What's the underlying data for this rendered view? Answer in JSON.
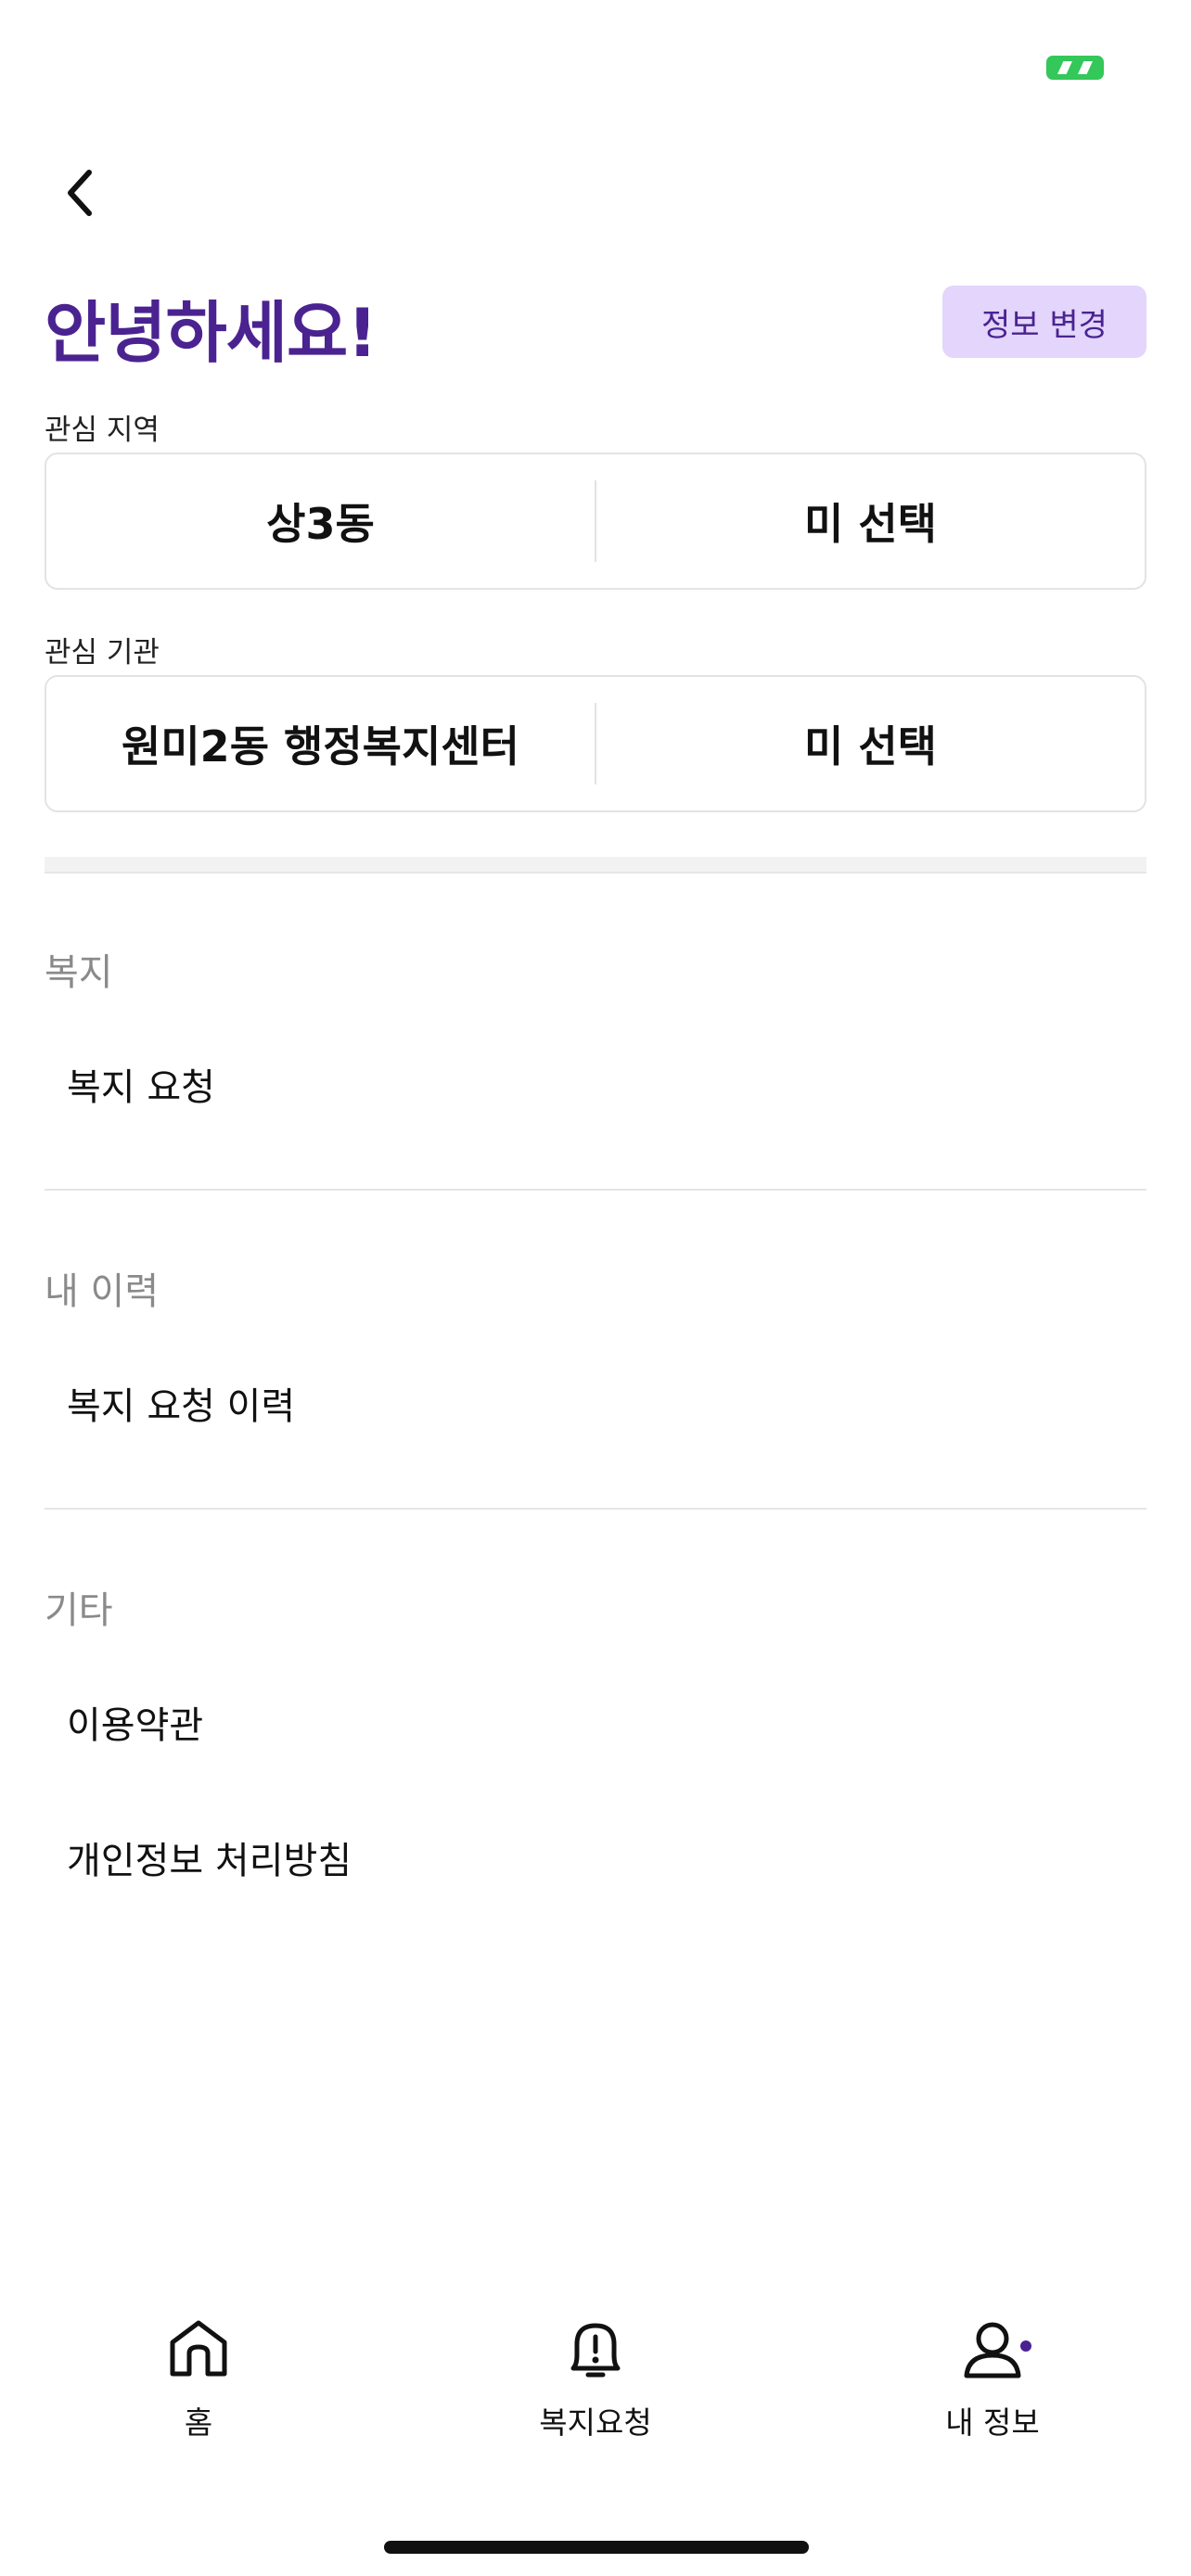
{
  "status_bar": {
    "indicator_color": "#34c759"
  },
  "header": {
    "back_icon": "chevron-left-icon"
  },
  "greeting": "안녕하세요!",
  "edit_button": "정보 변경",
  "interest_region": {
    "label": "관심 지역",
    "first": "상3동",
    "second": "미 선택"
  },
  "interest_agency": {
    "label": "관심 기관",
    "first": "원미2동 행정복지센터",
    "second": "미 선택"
  },
  "sections": {
    "welfare": {
      "title": "복지",
      "items": [
        "복지 요청"
      ]
    },
    "history": {
      "title": "내 이력",
      "items": [
        "복지 요청 이력"
      ]
    },
    "etc": {
      "title": "기타",
      "items": [
        "이용약관",
        "개인정보 처리방침"
      ]
    }
  },
  "tabbar": {
    "tabs": [
      {
        "label": "홈",
        "icon": "home-icon"
      },
      {
        "label": "복지요청",
        "icon": "alert-bell-icon"
      },
      {
        "label": "내 정보",
        "icon": "person-icon",
        "active": true
      }
    ]
  },
  "colors": {
    "accent": "#4a2391",
    "accent_light": "#e3d5fb"
  }
}
